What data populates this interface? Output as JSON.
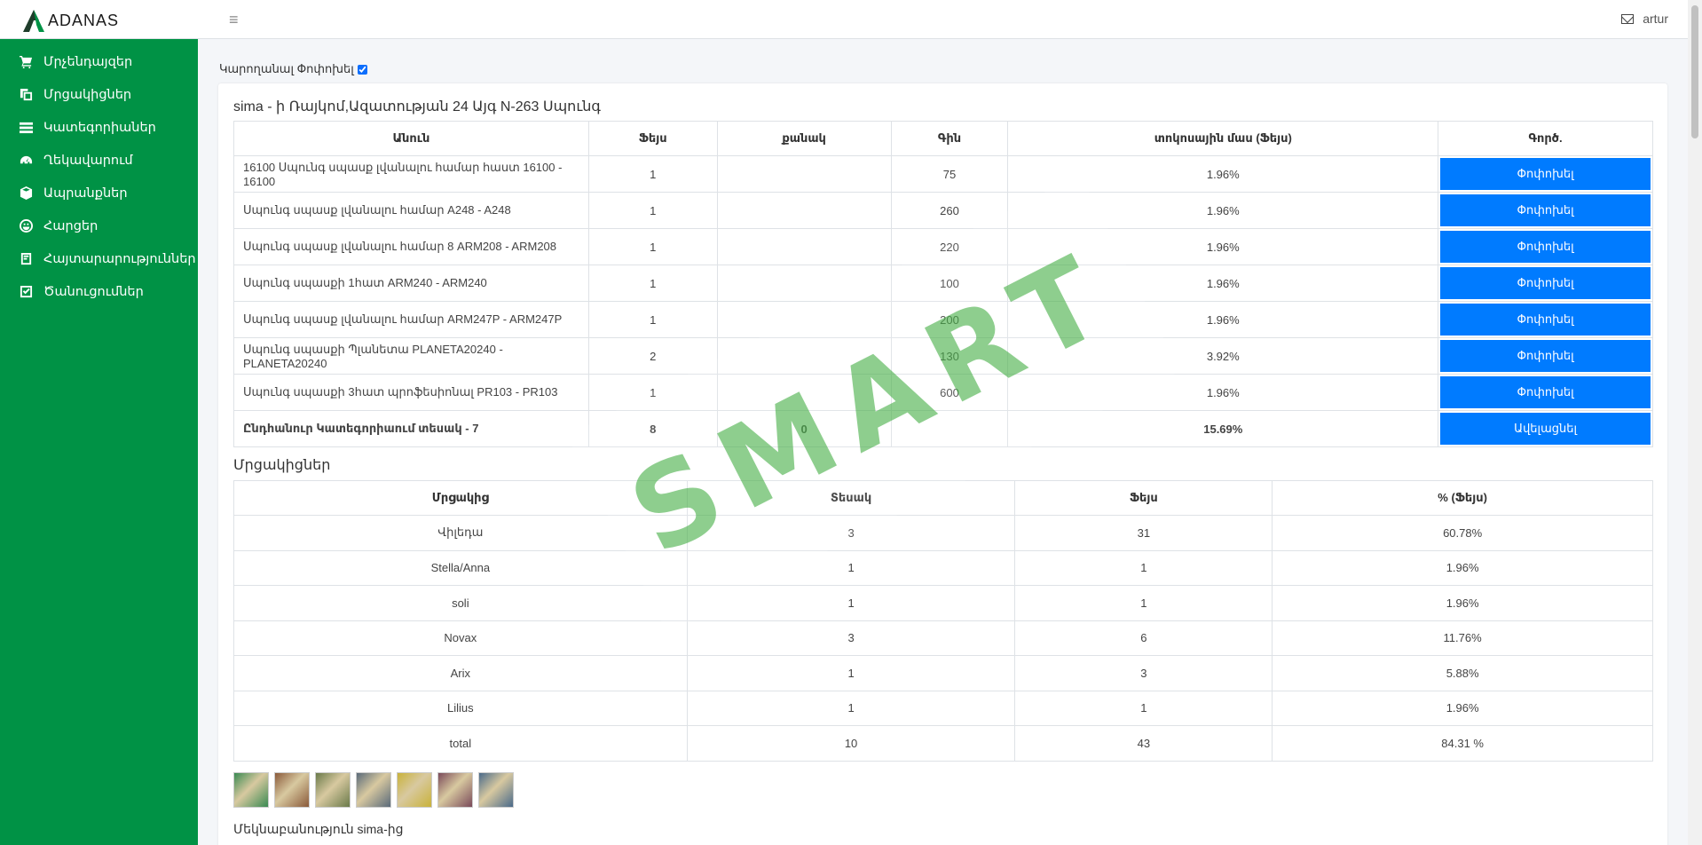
{
  "app": {
    "logo_text": "ADANAS",
    "user_name": "artur",
    "watermark": "SMART",
    "brand_green": "#009245",
    "accent_blue": "#007bff"
  },
  "sidebar": {
    "items": [
      {
        "label": "Մրչենդայզեր",
        "icon": "cart-icon"
      },
      {
        "label": "Մրցակիցներ",
        "icon": "copy-icon"
      },
      {
        "label": "Կատեգորիաներ",
        "icon": "list-icon"
      },
      {
        "label": "Ղեկավարում",
        "icon": "dashboard-icon"
      },
      {
        "label": "Ապրանքներ",
        "icon": "box-icon"
      },
      {
        "label": "Հարցեր",
        "icon": "smile-icon"
      },
      {
        "label": "Հայտարարություններ",
        "icon": "notice-icon"
      },
      {
        "label": "Ծանուցումներ",
        "icon": "check-square-icon"
      }
    ]
  },
  "toggle": {
    "label": "Կարողանալ Փոփոխել",
    "checked": true
  },
  "store_section": {
    "title": "sima - ի Ռայկոմ,Ազատության 24 Այգ N-263 Սպունգ",
    "headers": [
      "Անուն",
      "Ֆեյս",
      "քանակ",
      "Գին",
      "տոկոսային մաս (Ֆեյս)",
      "Գործ."
    ],
    "rows": [
      {
        "name": "16100 Սպունգ սպասք լվանալու համար հաստ 16100 - 16100",
        "face": "1",
        "qty": "",
        "price": "75",
        "pct": "1.96%",
        "action": "Փոփոխել"
      },
      {
        "name": "Սպունգ սպասք լվանալու համար A248 - A248",
        "face": "1",
        "qty": "",
        "price": "260",
        "pct": "1.96%",
        "action": "Փոփոխել"
      },
      {
        "name": "Սպունգ սպասք լվանալու համար 8 ARM208 - ARM208",
        "face": "1",
        "qty": "",
        "price": "220",
        "pct": "1.96%",
        "action": "Փոփոխել"
      },
      {
        "name": "Սպունգ սպասքի 1հատ ARM240 - ARM240",
        "face": "1",
        "qty": "",
        "price": "100",
        "pct": "1.96%",
        "action": "Փոփոխել"
      },
      {
        "name": "Սպունգ սպասք լվանալու համար ARM247P - ARM247P",
        "face": "1",
        "qty": "",
        "price": "200",
        "pct": "1.96%",
        "action": "Փոփոխել"
      },
      {
        "name": "Սպունգ սպասքի Պլանետա PLANETA20240 - PLANETA20240",
        "face": "2",
        "qty": "",
        "price": "130",
        "pct": "3.92%",
        "action": "Փոփոխել"
      },
      {
        "name": "Սպունգ սպասքի 3հատ պրոֆեսիոնալ PR103 - PR103",
        "face": "1",
        "qty": "",
        "price": "600",
        "pct": "1.96%",
        "action": "Փոփոխել"
      }
    ],
    "total": {
      "label": "Ընդհանուր Կատեգորիաում տեսակ - 7",
      "face": "8",
      "qty": "0",
      "price": "",
      "pct": "15.69%",
      "action": "Ավելացնել"
    }
  },
  "competitors_section": {
    "title": "Մրցակիցներ",
    "headers": [
      "Մրցակից",
      "Տեսակ",
      "Ֆեյս",
      "% (Ֆեյս)"
    ],
    "rows": [
      {
        "name": "Վիլեդա",
        "type": "3",
        "face": "31",
        "pct": "60.78%"
      },
      {
        "name": "Stella/Anna",
        "type": "1",
        "face": "1",
        "pct": "1.96%"
      },
      {
        "name": "soli",
        "type": "1",
        "face": "1",
        "pct": "1.96%"
      },
      {
        "name": "Novax",
        "type": "3",
        "face": "6",
        "pct": "11.76%"
      },
      {
        "name": "Arix",
        "type": "1",
        "face": "3",
        "pct": "5.88%"
      },
      {
        "name": "Lilius",
        "type": "1",
        "face": "1",
        "pct": "1.96%"
      },
      {
        "name": "total",
        "type": "10",
        "face": "43",
        "pct": "84.31 %"
      }
    ]
  },
  "photos": {
    "count_label": "7",
    "colors": [
      "#3a8a52",
      "#8a5a3a",
      "#6a7a4a",
      "#5a6a7a",
      "#c9b23a",
      "#7a4a5a",
      "#4a6a8a"
    ]
  },
  "footer_text": "Մեկնաբանություն sima-ից"
}
